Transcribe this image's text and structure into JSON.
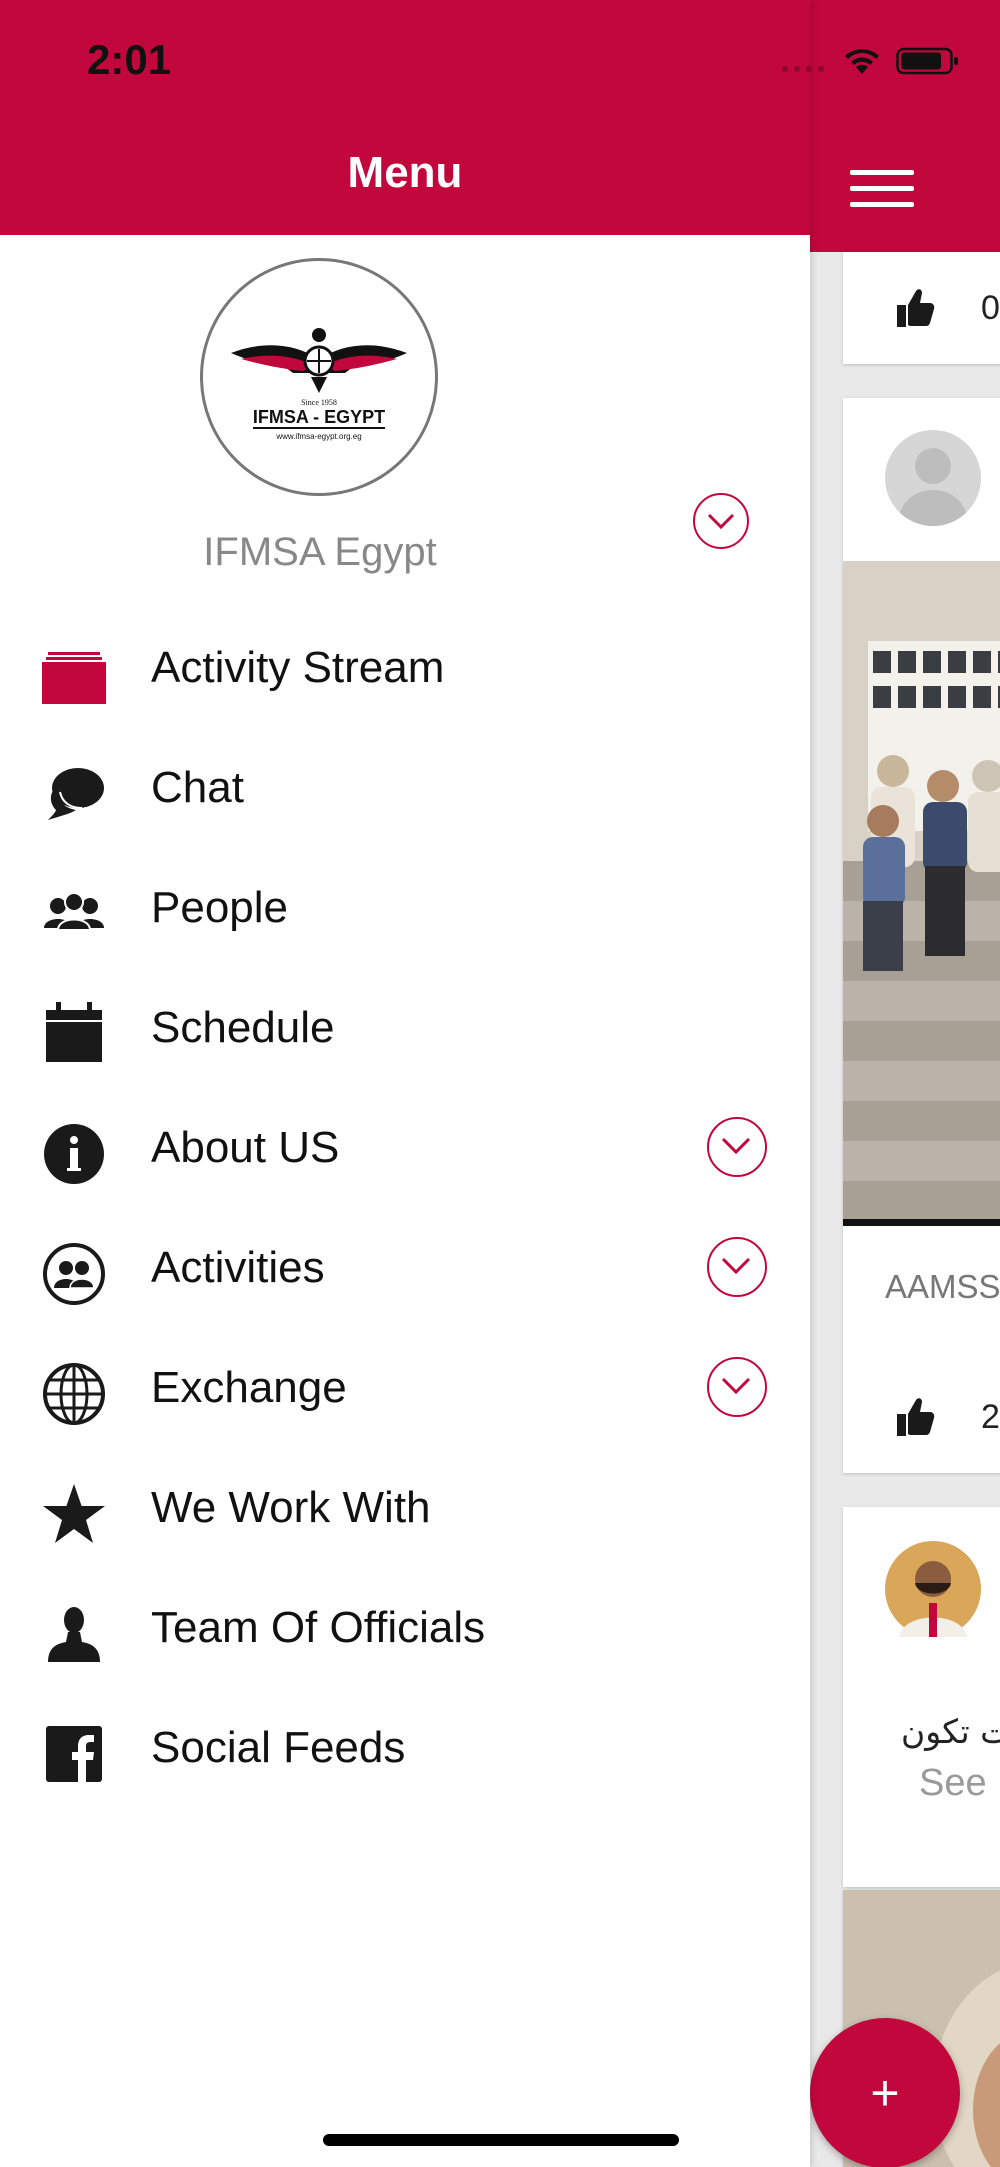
{
  "status_bar": {
    "time": "2:01"
  },
  "drawer": {
    "title": "Menu",
    "profile": {
      "name": "IFMSA Egypt",
      "logo_text": "IFMSA - EGYPT",
      "logo_url_text": "www.ifmsa-egypt.org.eg",
      "logo_since": "Since 1958"
    },
    "items": [
      {
        "label": "Activity Stream",
        "icon": "activity-stream-icon",
        "expandable": false
      },
      {
        "label": "Chat",
        "icon": "chat-bubbles-icon",
        "expandable": false
      },
      {
        "label": "People",
        "icon": "people-group-icon",
        "expandable": false
      },
      {
        "label": "Schedule",
        "icon": "calendar-icon",
        "expandable": false
      },
      {
        "label": "About US",
        "icon": "info-icon",
        "expandable": true
      },
      {
        "label": "Activities",
        "icon": "activities-icon",
        "expandable": true
      },
      {
        "label": "Exchange",
        "icon": "globe-icon",
        "expandable": true
      },
      {
        "label": "We Work With",
        "icon": "star-icon",
        "expandable": false
      },
      {
        "label": "Team Of Officials",
        "icon": "person-icon",
        "expandable": false
      },
      {
        "label": "Social Feeds",
        "icon": "facebook-icon",
        "expandable": false
      }
    ]
  },
  "feed": {
    "cards": [
      {
        "likes": "0"
      },
      {
        "caption": "AAMSS",
        "likes": "2"
      },
      {
        "text_line": "ت تكون",
        "see_more": "See"
      }
    ],
    "fab_label": "+"
  },
  "colors": {
    "brand": "#c2073c",
    "icon": "#1a1a1a"
  }
}
